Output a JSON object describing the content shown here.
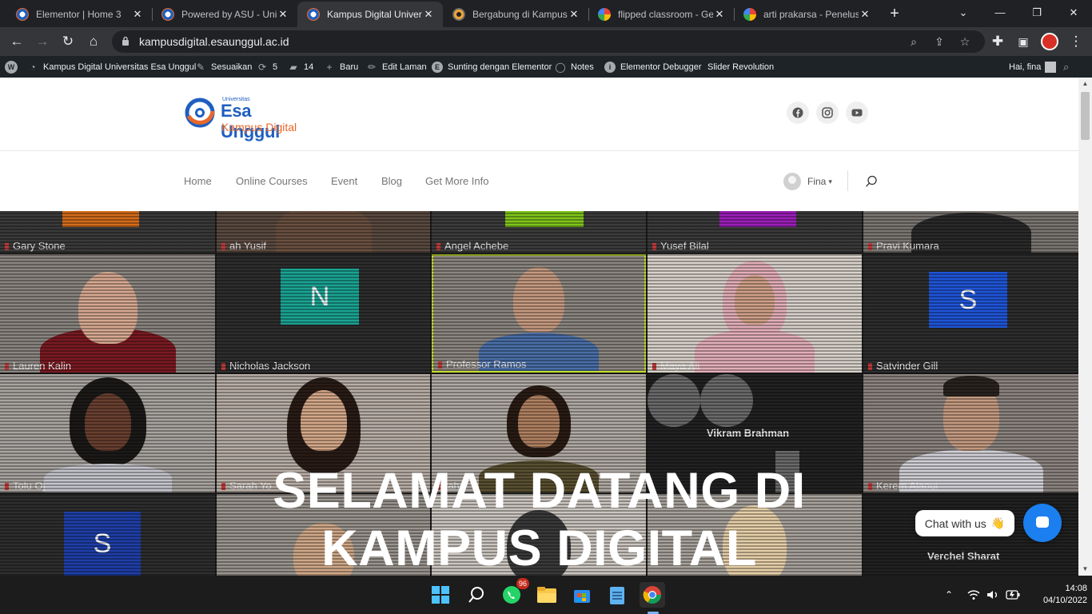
{
  "browser": {
    "tabs": [
      {
        "title": "Elementor | Home 3",
        "favicon": "ue-icon"
      },
      {
        "title": "Powered by ASU - Uni",
        "favicon": "ue-icon"
      },
      {
        "title": "Kampus Digital Univer",
        "favicon": "ue-icon",
        "active": true
      },
      {
        "title": "Bergabung di Kampus",
        "favicon": "eye-icon"
      },
      {
        "title": "flipped classroom - Ge",
        "favicon": "google-icon"
      },
      {
        "title": "arti prakarsa - Penelus",
        "favicon": "google-icon"
      }
    ],
    "close_glyph": "✕",
    "new_tab_glyph": "+",
    "url": "kampusdigital.esaunggul.ac.id"
  },
  "adminbar": {
    "site_name": "Kampus Digital Universitas Esa Unggul",
    "customize": "Sesuaikan",
    "updates_count": "5",
    "comments_count": "14",
    "new": "Baru",
    "edit_page": "Edit Laman",
    "edit_elementor": "Sunting dengan Elementor",
    "notes": "Notes",
    "debugger": "Elementor Debugger",
    "slider": "Slider Revolution",
    "greeting": "Hai, fina"
  },
  "site": {
    "logo": {
      "small": "Universitas",
      "name": "Esa Unggul",
      "sub": "Kampus Digital"
    },
    "social": [
      "facebook-icon",
      "instagram-icon",
      "youtube-icon"
    ],
    "nav": [
      "Home",
      "Online Courses",
      "Event",
      "Blog",
      "Get More Info"
    ],
    "user": "Fina",
    "hero": {
      "title_line1": "SELAMAT DATANG DI",
      "title_line2": "KAMPUS DIGITAL",
      "participants": {
        "r0c0": "Gary Stone",
        "r0c1": "ah Yusif",
        "r0c2": "Angel Achebe",
        "r0c3": "Yusef Bilal",
        "r0c4": "Pravi Kumara",
        "r1c0": "Lauren Kalin",
        "r1c1": "Nicholas Jackson",
        "r1c2": "Professor Ramos",
        "r1c3": "Maya Ali",
        "r1c4": "Satvinder Gill",
        "r2c0": "Tolu Oj",
        "r2c1": "Sarah Yo",
        "r2c2": "raha",
        "r2c3": "Vikram Brahman",
        "r2c4": "Kerem Alaoui",
        "r3c4": "Verchel Sharat"
      },
      "avatar_letters": {
        "nicholas": "N",
        "satvinder": "S",
        "bottom": "S"
      }
    },
    "chat": {
      "label": "Chat with us",
      "emoji": "👋"
    }
  },
  "taskbar": {
    "whatsapp_badge": "96",
    "time": "14:08",
    "date": "04/10/2022"
  },
  "colors": {
    "brand_blue": "#1f5fbf",
    "brand_orange": "#e8672a",
    "chat_blue": "#1b7ff0"
  }
}
